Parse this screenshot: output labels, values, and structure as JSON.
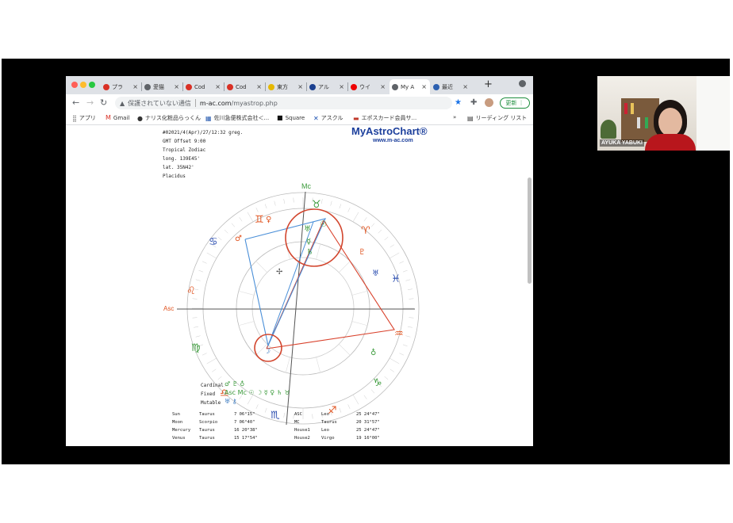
{
  "browser": {
    "tabs": [
      {
        "label": "プラ",
        "icon": "gmail-icon",
        "color": "#d93025"
      },
      {
        "label": "愛猫",
        "icon": "globe-icon",
        "color": "#5f6368"
      },
      {
        "label": "Cod",
        "icon": "codoc-icon",
        "color": "#d93025"
      },
      {
        "label": "Cod",
        "icon": "codoc-icon",
        "color": "#d93025"
      },
      {
        "label": "東方",
        "icon": "bookmark-icon",
        "color": "#e6b800"
      },
      {
        "label": "アル",
        "icon": "site-icon",
        "color": "#1a3f8f"
      },
      {
        "label": "ウイ",
        "icon": "yahoo-icon",
        "color": "#e00"
      },
      {
        "label": "My A",
        "icon": "globe-icon",
        "color": "#5f6368",
        "active": true
      },
      {
        "label": "最近",
        "icon": "site-icon",
        "color": "#2b5fb0"
      }
    ],
    "new_tab": "+",
    "security_label": "保護されていない通信",
    "url_host": "m-ac.com",
    "url_path": "/myastrop.php",
    "update_label": "更新",
    "bookmarks": [
      {
        "label": "アプリ",
        "icon": "apps-icon"
      },
      {
        "label": "Gmail",
        "icon": "gmail-icon"
      },
      {
        "label": "ナリス化粧品らっくん",
        "icon": "globe-icon"
      },
      {
        "label": "佐川急便株式会社＜...",
        "icon": "document-icon"
      },
      {
        "label": "Square",
        "icon": "square-icon"
      },
      {
        "label": "アスクル",
        "icon": "askul-icon"
      },
      {
        "label": "エポスカード会員サ...",
        "icon": "card-icon"
      }
    ],
    "bookmarks_more": "»",
    "reading_list": "リーディング リスト"
  },
  "chart": {
    "logo_title": "MyAstroChart®",
    "logo_url": "www.m-ac.com",
    "info_lines": [
      "#02021/4(Apr)/27/12:32 greg.",
      "GMT Offset 9:00",
      "Tropical Zodiac",
      "long. 139E45'",
      "lat. 35N42'",
      "Placidus"
    ],
    "mc_label": "Mc",
    "asc_label": "Asc",
    "colors": {
      "fire": "#e0531f",
      "earth": "#3a9a3a",
      "air": "#3a7ac0",
      "water": "#2a4db0",
      "red_line": "#d9412b",
      "blue_line": "#4a8fd8"
    },
    "legend": {
      "cardinal_label": "Cardinal",
      "fixed_label": "Fixed",
      "mutable_label": "Mutable",
      "cardinal_glyphs": "♂ ♇ ♁",
      "fixed_glyphs": "Asc Mc ☉ ☽ ☿ ♀ ♄ ♉",
      "mutable_glyphs": "♅ ⚷"
    },
    "positions_left": [
      {
        "planet": "Sun",
        "sign": "Taurus",
        "degree": "7 06°15\""
      },
      {
        "planet": "Moon",
        "sign": "Scorpio",
        "degree": "7 06°40\""
      },
      {
        "planet": "Mercury",
        "sign": "Taurus",
        "degree": "16 20°38\""
      },
      {
        "planet": "Venus",
        "sign": "Taurus",
        "degree": "15 17°54\""
      }
    ],
    "positions_right": [
      {
        "planet": "ASC",
        "sign": "Leo",
        "degree": "25 24°47\""
      },
      {
        "planet": "MC",
        "sign": "Taurus",
        "degree": "20 31°57\""
      },
      {
        "planet": "House1",
        "sign": "Leo",
        "degree": "25 24°47\""
      },
      {
        "planet": "House2",
        "sign": "Virgo",
        "degree": "19 16°00\""
      }
    ]
  },
  "video": {
    "participant_name": "AYUKA YABUKI"
  }
}
